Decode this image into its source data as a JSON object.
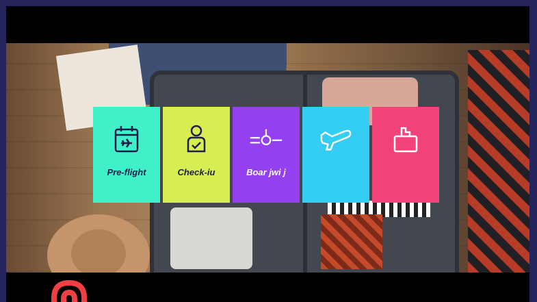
{
  "cards": [
    {
      "label": "Pre-flight",
      "color": "#3ff0c9",
      "icon": "calendar-plane-icon"
    },
    {
      "label": "Check-iu",
      "color": "#d9ec52",
      "icon": "person-check-icon"
    },
    {
      "label": "Boar jwi j",
      "color": "#9440ee",
      "icon": "plane-front-icon"
    },
    {
      "label": "",
      "color": "#34cdf3",
      "icon": "plane-icon"
    },
    {
      "label": "",
      "color": "#f1437a",
      "icon": "bag-icon"
    }
  ],
  "colors": {
    "border": "#24255c",
    "logo": "#ee3f45"
  }
}
